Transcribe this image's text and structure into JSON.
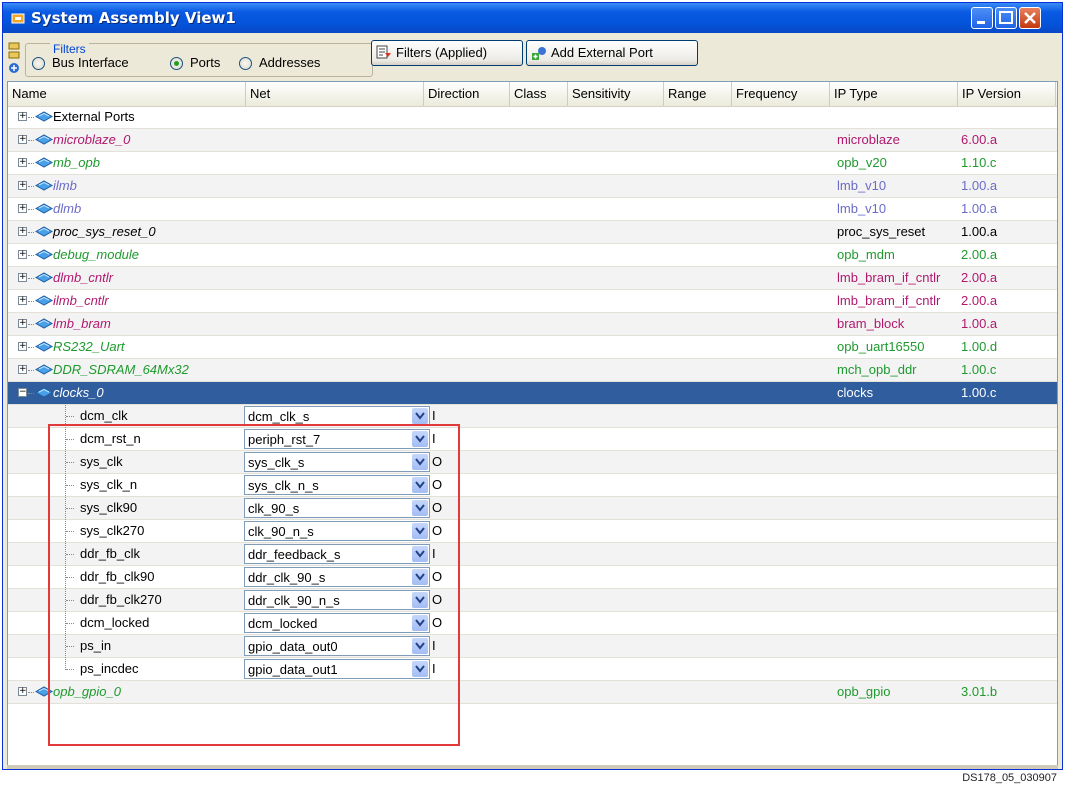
{
  "window": {
    "title": "System Assembly View1"
  },
  "filters": {
    "group_label": "Filters",
    "options": [
      "Bus Interface",
      "Ports",
      "Addresses"
    ],
    "selected": "Ports",
    "filters_button": "Filters (Applied)",
    "add_port_button": "Add External Port"
  },
  "columns": [
    "Name",
    "Net",
    "Direction",
    "Class",
    "Sensitivity",
    "Range",
    "Frequency",
    "IP Type",
    "IP Version"
  ],
  "instances_top": [
    {
      "name": "External Ports",
      "ip_type": "",
      "ip_version": "",
      "color": "#000000"
    },
    {
      "name": "microblaze_0",
      "ip_type": "microblaze",
      "ip_version": "6.00.a",
      "color": "#b0186e"
    },
    {
      "name": "mb_opb",
      "ip_type": "opb_v20",
      "ip_version": "1.10.c",
      "color": "#1e9a2e"
    },
    {
      "name": "ilmb",
      "ip_type": "lmb_v10",
      "ip_version": "1.00.a",
      "color": "#6b6bc8"
    },
    {
      "name": "dlmb",
      "ip_type": "lmb_v10",
      "ip_version": "1.00.a",
      "color": "#6b6bc8"
    },
    {
      "name": "proc_sys_reset_0",
      "ip_type": "proc_sys_reset",
      "ip_version": "1.00.a",
      "color": "#000000"
    },
    {
      "name": "debug_module",
      "ip_type": "opb_mdm",
      "ip_version": "2.00.a",
      "color": "#1e9a2e"
    },
    {
      "name": "dlmb_cntlr",
      "ip_type": "lmb_bram_if_cntlr",
      "ip_version": "2.00.a",
      "color": "#b0186e"
    },
    {
      "name": "ilmb_cntlr",
      "ip_type": "lmb_bram_if_cntlr",
      "ip_version": "2.00.a",
      "color": "#b0186e"
    },
    {
      "name": "lmb_bram",
      "ip_type": "bram_block",
      "ip_version": "1.00.a",
      "color": "#b0186e"
    },
    {
      "name": "RS232_Uart",
      "ip_type": "opb_uart16550",
      "ip_version": "1.00.d",
      "color": "#1e9a2e"
    },
    {
      "name": "DDR_SDRAM_64Mx32",
      "ip_type": "mch_opb_ddr",
      "ip_version": "1.00.c",
      "color": "#1e9a2e"
    }
  ],
  "selected_instance": {
    "name": "clocks_0",
    "ip_type": "clocks",
    "ip_version": "1.00.c"
  },
  "ports": [
    {
      "name": "dcm_clk",
      "net": "dcm_clk_s",
      "dir": "I"
    },
    {
      "name": "dcm_rst_n",
      "net": "periph_rst_7",
      "dir": "I"
    },
    {
      "name": "sys_clk",
      "net": "sys_clk_s",
      "dir": "O"
    },
    {
      "name": "sys_clk_n",
      "net": "sys_clk_n_s",
      "dir": "O"
    },
    {
      "name": "sys_clk90",
      "net": "clk_90_s",
      "dir": "O"
    },
    {
      "name": "sys_clk270",
      "net": "clk_90_n_s",
      "dir": "O"
    },
    {
      "name": "ddr_fb_clk",
      "net": "ddr_feedback_s",
      "dir": "I"
    },
    {
      "name": "ddr_fb_clk90",
      "net": "ddr_clk_90_s",
      "dir": "O"
    },
    {
      "name": "ddr_fb_clk270",
      "net": "ddr_clk_90_n_s",
      "dir": "O"
    },
    {
      "name": "dcm_locked",
      "net": "dcm_locked",
      "dir": "O"
    },
    {
      "name": "ps_in",
      "net": "gpio_data_out0",
      "dir": "I"
    },
    {
      "name": "ps_incdec",
      "net": "gpio_data_out1",
      "dir": "I"
    }
  ],
  "instance_bottom": {
    "name": "opb_gpio_0",
    "ip_type": "opb_gpio",
    "ip_version": "3.01.b",
    "color": "#1e9a2e"
  },
  "footnote": "DS178_05_030907"
}
